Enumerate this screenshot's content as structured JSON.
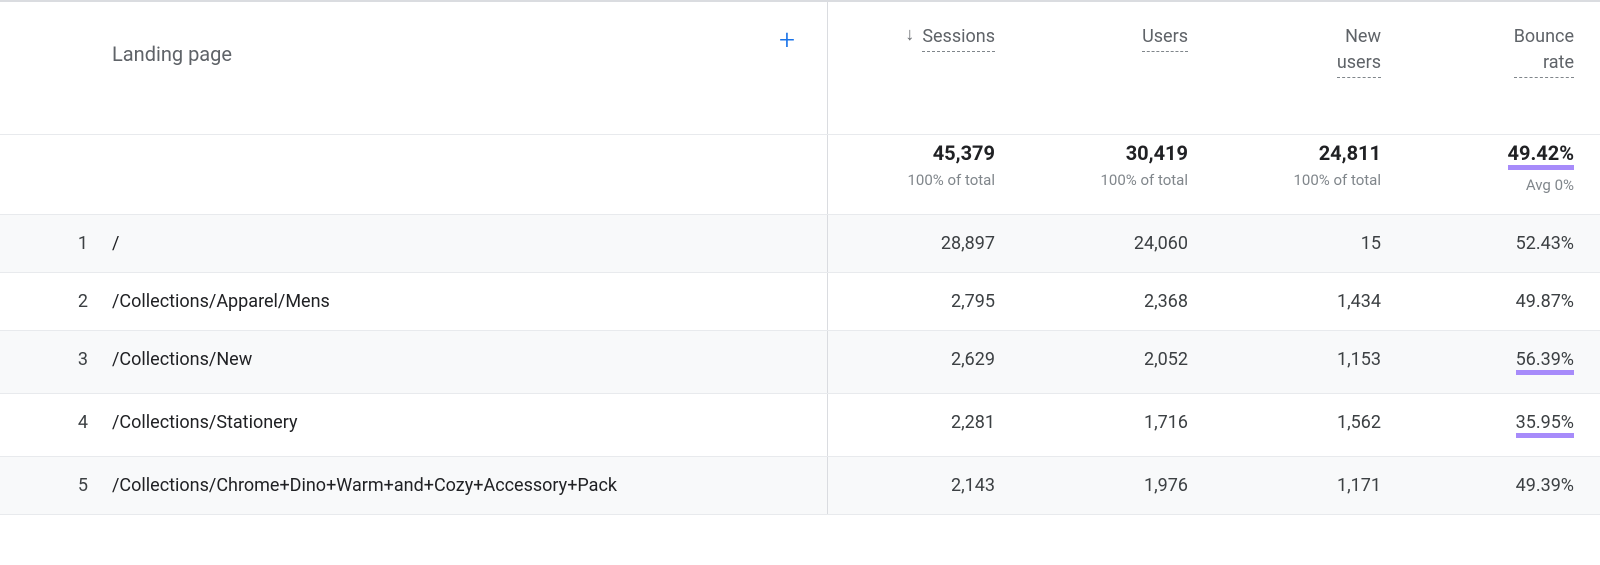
{
  "dimension_header": "Landing page",
  "metrics": [
    {
      "label": "Sessions",
      "sorted": true,
      "total": "45,379",
      "total_sub": "100% of total",
      "total_hl": false
    },
    {
      "label": "Users",
      "sorted": false,
      "total": "30,419",
      "total_sub": "100% of total",
      "total_hl": false
    },
    {
      "label": "New users",
      "sorted": false,
      "total": "24,811",
      "total_sub": "100% of total",
      "total_hl": false
    },
    {
      "label": "Bounce rate",
      "sorted": false,
      "total": "49.42%",
      "total_sub": "Avg 0%",
      "total_hl": true
    }
  ],
  "rows": [
    {
      "idx": "1",
      "page": "/",
      "values": [
        "28,897",
        "24,060",
        "15",
        "52.43%"
      ],
      "hl": [
        false,
        false,
        false,
        false
      ]
    },
    {
      "idx": "2",
      "page": "/Collections/Apparel/Mens",
      "values": [
        "2,795",
        "2,368",
        "1,434",
        "49.87%"
      ],
      "hl": [
        false,
        false,
        false,
        false
      ]
    },
    {
      "idx": "3",
      "page": "/Collections/New",
      "values": [
        "2,629",
        "2,052",
        "1,153",
        "56.39%"
      ],
      "hl": [
        false,
        false,
        false,
        true
      ]
    },
    {
      "idx": "4",
      "page": "/Collections/Stationery",
      "values": [
        "2,281",
        "1,716",
        "1,562",
        "35.95%"
      ],
      "hl": [
        false,
        false,
        false,
        true
      ]
    },
    {
      "idx": "5",
      "page": "/Collections/Chrome+Dino+Warm+and+Cozy+Accessory+Pack",
      "values": [
        "2,143",
        "1,976",
        "1,171",
        "49.39%"
      ],
      "hl": [
        false,
        false,
        false,
        false
      ]
    }
  ]
}
